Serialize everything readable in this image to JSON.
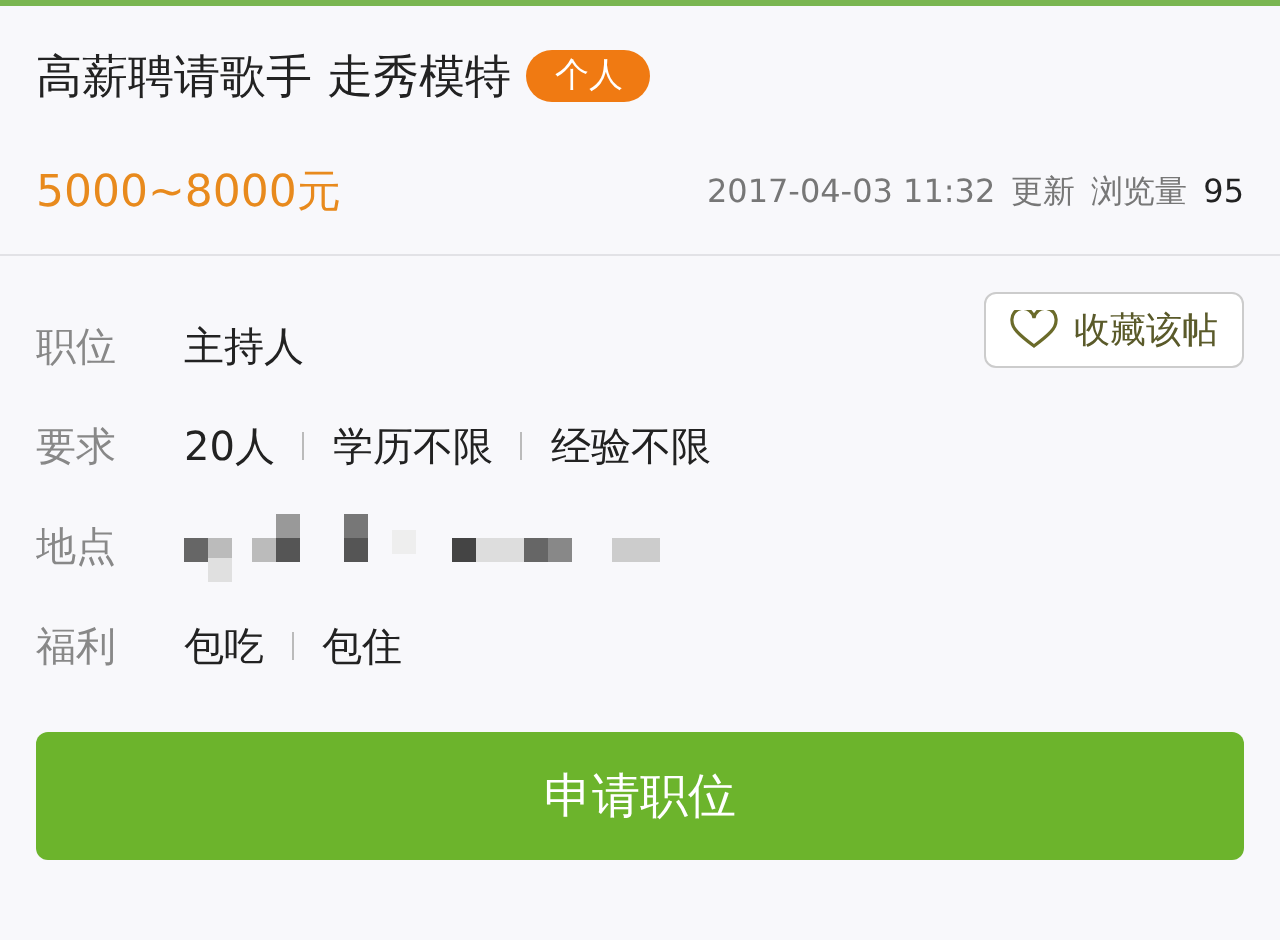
{
  "post": {
    "title": "高薪聘请歌手 走秀模特",
    "tag": "个人",
    "salary": "5000~8000元",
    "updated_time": "2017-04-03 11:32",
    "updated_label": "更新",
    "views_label": "浏览量",
    "views": "95"
  },
  "details": [
    {
      "kind": "text",
      "label": "职位",
      "values": [
        "主持人"
      ]
    },
    {
      "kind": "text",
      "label": "要求",
      "values": [
        "20人",
        "学历不限",
        "经验不限"
      ]
    },
    {
      "kind": "redacted",
      "label": "地点"
    },
    {
      "kind": "text",
      "label": "福利",
      "values": [
        "包吃",
        "包住"
      ]
    }
  ],
  "favorite_button": "收藏该帖",
  "apply_button": "申请职位"
}
